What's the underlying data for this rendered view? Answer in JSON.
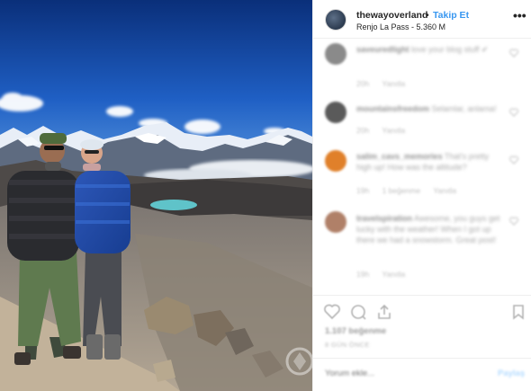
{
  "header": {
    "username": "thewayoverland",
    "separator": "•",
    "follow_label": "Takip Et",
    "location": "Renjo La Pass - 5.360 M",
    "more_label": "•••"
  },
  "comments": [
    {
      "user": "saveuredlight",
      "text": "love your blog stuff ✔",
      "meta": [
        "20h",
        "Yanıtla"
      ]
    },
    {
      "user": "mountainsfreedom",
      "text": "Selamlar, anlama!",
      "meta": [
        "20h",
        "Yanıtla"
      ]
    },
    {
      "user": "salim_cavs_memories",
      "text": "That's pretty high up! How was the altitude?",
      "meta": [
        "19h",
        "1 beğenme",
        "Yanıtla"
      ]
    },
    {
      "user": "travelspiration",
      "text": "Awesome, you guys get lucky with the weather! When I got up there we had a snowstorm. Great post!",
      "meta": [
        "19h",
        "Yanıtla"
      ]
    }
  ],
  "footer": {
    "likes": "1.107 beğenme",
    "date": "8 GÜN ÖNCE",
    "comment_placeholder": "Yorum ekle...",
    "post_label": "Paylaş"
  },
  "icons": {
    "like": "heart-icon",
    "comment": "comment-icon",
    "share": "share-icon",
    "save": "bookmark-icon"
  },
  "colors": {
    "follow_blue": "#3897f0",
    "border": "#efefef",
    "sky_top": "#0b3d91",
    "lake": "#5fc3c9"
  }
}
